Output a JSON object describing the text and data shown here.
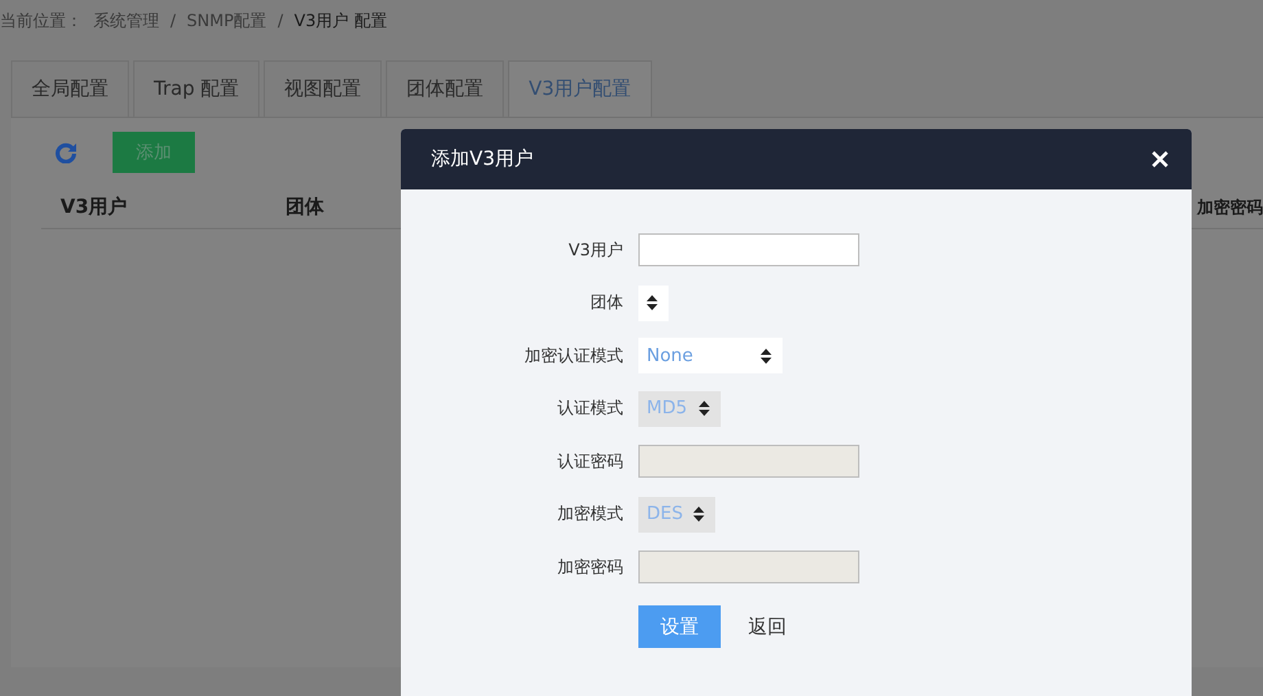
{
  "breadcrumb": {
    "label": "当前位置：",
    "separator": "/",
    "items": [
      "系统管理",
      "SNMP配置",
      "V3用户 配置"
    ]
  },
  "tabs": [
    {
      "label": "全局配置",
      "selected": false
    },
    {
      "label": "Trap 配置",
      "selected": false
    },
    {
      "label": "视图配置",
      "selected": false
    },
    {
      "label": "团体配置",
      "selected": false
    },
    {
      "label": "V3用户配置",
      "selected": true
    }
  ],
  "toolbar": {
    "add_button": "添加"
  },
  "table": {
    "columns": [
      "V3用户",
      "团体",
      "加密密码"
    ]
  },
  "dialog": {
    "title": "添加V3用户",
    "fields": [
      {
        "label": "V3用户",
        "kind": "text",
        "disabled": false
      },
      {
        "label": "团体",
        "kind": "select",
        "disabled": false
      },
      {
        "label": "加密认证模式",
        "kind": "select",
        "value": "None",
        "disabled": false
      },
      {
        "label": "认证模式",
        "kind": "select",
        "value": "MD5",
        "disabled": true
      },
      {
        "label": "认证密码",
        "kind": "text",
        "disabled": true
      },
      {
        "label": "加密模式",
        "kind": "select",
        "value": "DES",
        "disabled": true
      },
      {
        "label": "加密密码",
        "kind": "text",
        "disabled": true
      }
    ],
    "submit_button": "设置",
    "back_link": "返回"
  }
}
